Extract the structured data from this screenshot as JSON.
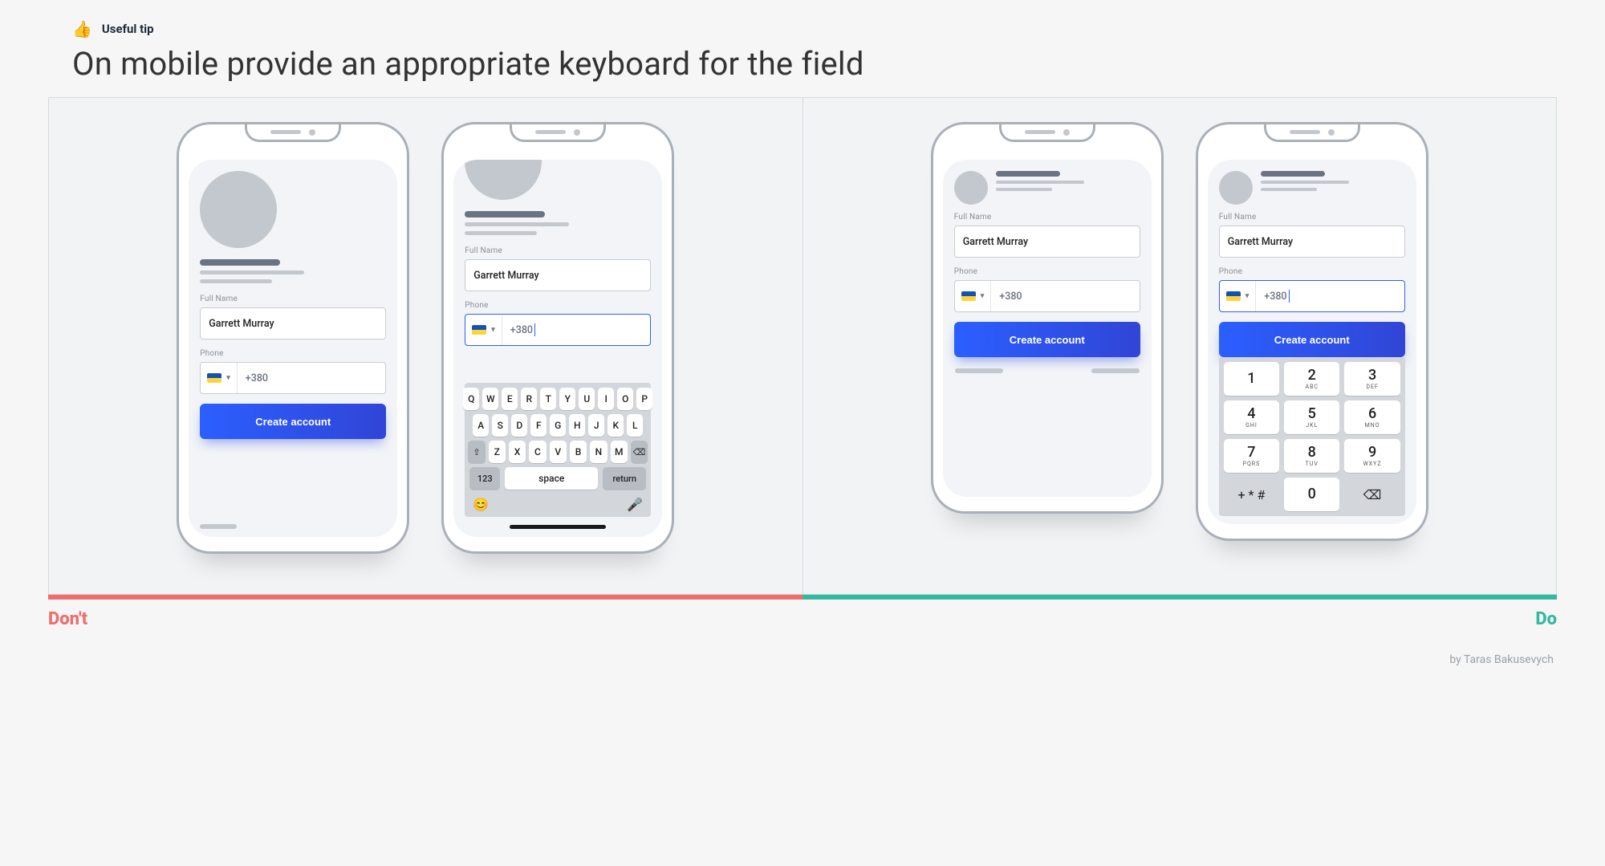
{
  "header": {
    "tip_label": "Useful tip",
    "title": "On mobile provide an appropriate keyboard for the field"
  },
  "labels": {
    "dont": "Don't",
    "do": "Do"
  },
  "form": {
    "fullname_label": "Full Name",
    "fullname_value": "Garrett Murray",
    "phone_label": "Phone",
    "phone_prefix": "+380",
    "cta": "Create account"
  },
  "qwerty": {
    "row1": [
      "Q",
      "W",
      "E",
      "R",
      "T",
      "Y",
      "U",
      "I",
      "O",
      "P"
    ],
    "row2": [
      "A",
      "S",
      "D",
      "F",
      "G",
      "H",
      "J",
      "K",
      "L"
    ],
    "row3": [
      "Z",
      "X",
      "C",
      "V",
      "B",
      "N",
      "M"
    ],
    "shift": "⇧",
    "backspace": "⌫",
    "num": "123",
    "space": "space",
    "return": "return",
    "emoji": "😊",
    "mic": "🎤"
  },
  "numpad": {
    "keys": [
      {
        "n": "1",
        "s": ""
      },
      {
        "n": "2",
        "s": "ABC"
      },
      {
        "n": "3",
        "s": "DEF"
      },
      {
        "n": "4",
        "s": "GHI"
      },
      {
        "n": "5",
        "s": "JKL"
      },
      {
        "n": "6",
        "s": "MNO"
      },
      {
        "n": "7",
        "s": "PQRS"
      },
      {
        "n": "8",
        "s": "TUV"
      },
      {
        "n": "9",
        "s": "WXYZ"
      }
    ],
    "sym": "+ * #",
    "zero": "0",
    "backspace": "⌫"
  },
  "credits": "by Taras Bakusevych"
}
